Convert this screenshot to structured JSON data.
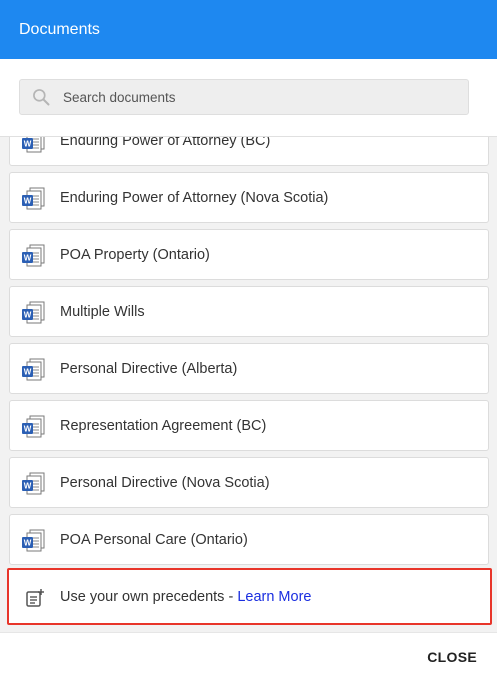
{
  "header": {
    "title": "Documents"
  },
  "search": {
    "placeholder": "Search documents",
    "value": ""
  },
  "documents": [
    {
      "label": "Enduring Power of Attorney (BC)",
      "icon": "word-document-icon"
    },
    {
      "label": "Enduring Power of Attorney (Nova Scotia)",
      "icon": "word-document-icon"
    },
    {
      "label": "POA Property (Ontario)",
      "icon": "word-document-icon"
    },
    {
      "label": "Multiple Wills",
      "icon": "word-document-icon"
    },
    {
      "label": "Personal Directive (Alberta)",
      "icon": "word-document-icon"
    },
    {
      "label": "Representation Agreement (BC)",
      "icon": "word-document-icon"
    },
    {
      "label": "Personal Directive (Nova Scotia)",
      "icon": "word-document-icon"
    },
    {
      "label": "POA Personal Care (Ontario)",
      "icon": "word-document-icon"
    }
  ],
  "precedents": {
    "text": "Use your own precedents - ",
    "link": "Learn More",
    "icon": "add-document-icon"
  },
  "footer": {
    "close_label": "CLOSE"
  },
  "colors": {
    "header_bg": "#1e88f0",
    "highlight_border": "#e8352a",
    "link": "#1a2ee0",
    "word_blue": "#2b5fb4"
  }
}
